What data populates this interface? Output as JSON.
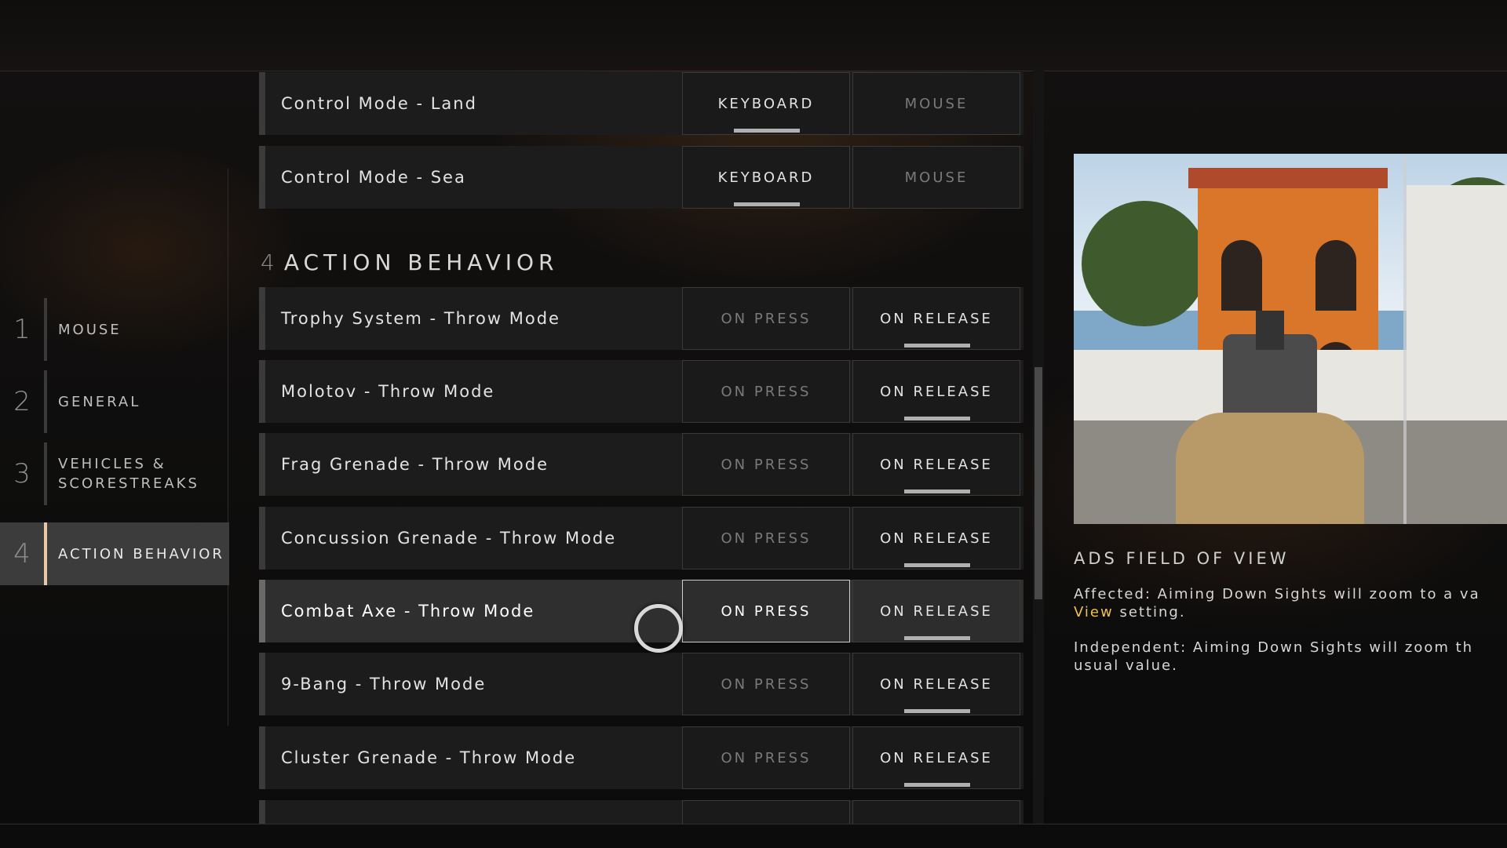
{
  "nav": {
    "items": [
      {
        "num": "1",
        "label": "MOUSE"
      },
      {
        "num": "2",
        "label": "GENERAL"
      },
      {
        "num": "3",
        "label": "VEHICLES &\nSCORESTREAKS"
      },
      {
        "num": "4",
        "label": "ACTION BEHAVIOR"
      }
    ]
  },
  "control_rows": [
    {
      "label": "Control Mode - Land",
      "opt1": "KEYBOARD",
      "opt2": "MOUSE"
    },
    {
      "label": "Control Mode - Sea",
      "opt1": "KEYBOARD",
      "opt2": "MOUSE"
    }
  ],
  "section": {
    "num": "4",
    "title": "ACTION BEHAVIOR"
  },
  "action_rows": [
    {
      "label": "Trophy System - Throw Mode",
      "opt1": "ON PRESS",
      "opt2": "ON RELEASE"
    },
    {
      "label": "Molotov - Throw Mode",
      "opt1": "ON PRESS",
      "opt2": "ON RELEASE"
    },
    {
      "label": "Frag Grenade - Throw Mode",
      "opt1": "ON PRESS",
      "opt2": "ON RELEASE"
    },
    {
      "label": "Concussion Grenade - Throw Mode",
      "opt1": "ON PRESS",
      "opt2": "ON RELEASE"
    },
    {
      "label": "Combat Axe - Throw Mode",
      "opt1": "ON PRESS",
      "opt2": "ON RELEASE"
    },
    {
      "label": "9-Bang - Throw Mode",
      "opt1": "ON PRESS",
      "opt2": "ON RELEASE"
    },
    {
      "label": "Cluster Grenade - Throw Mode",
      "opt1": "ON PRESS",
      "opt2": "ON RELEASE"
    }
  ],
  "info": {
    "title": "ADS FIELD OF VIEW",
    "affected_prefix": "Affected: Aiming Down Sights will zoom to a va",
    "affected_highlight": "View",
    "affected_suffix": " setting.",
    "independent_line1": "Independent: Aiming Down Sights will zoom th",
    "independent_line2": "usual value."
  }
}
